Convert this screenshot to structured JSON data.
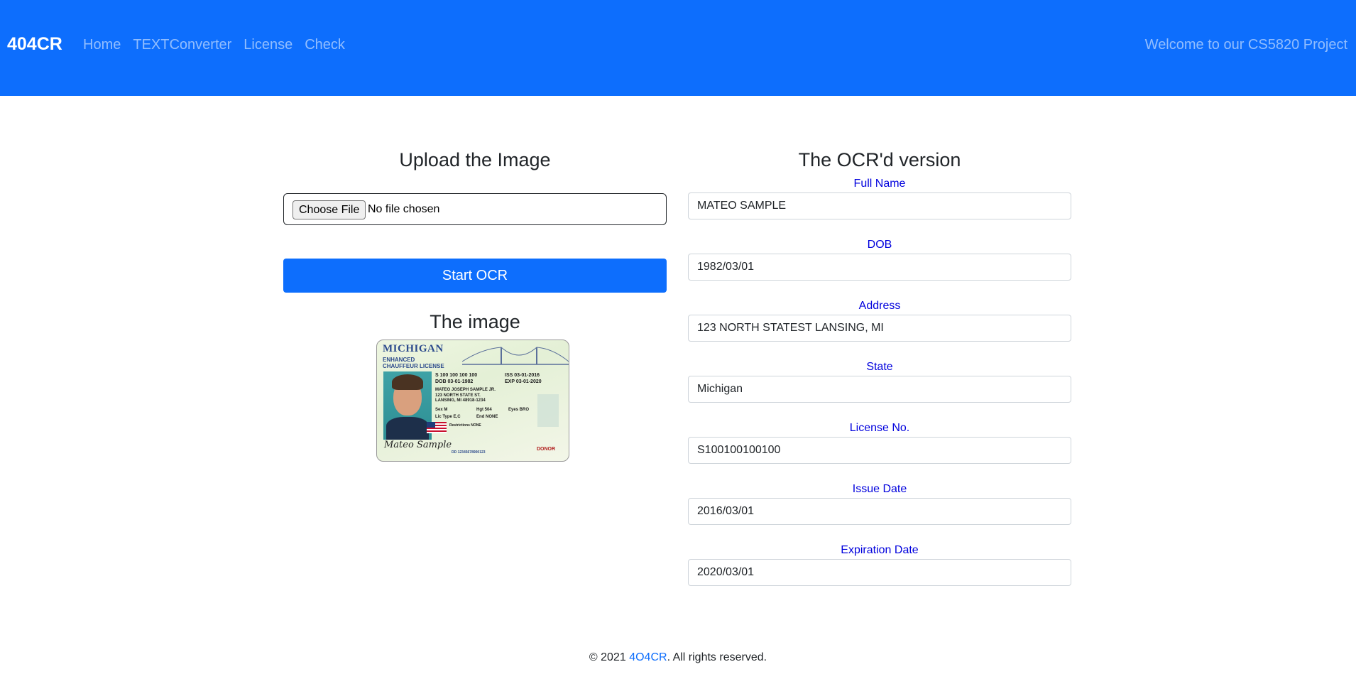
{
  "navbar": {
    "brand": "404CR",
    "links": [
      "Home",
      "TEXTConverter",
      "License",
      "Check"
    ],
    "welcome": "Welcome to our CS5820 Project",
    "background_color": "#0d6efd"
  },
  "upload": {
    "heading": "Upload the Image",
    "choose_file_label": "Choose File",
    "file_status": "No file chosen",
    "start_button": "Start OCR",
    "image_heading": "The image"
  },
  "license_image": {
    "state_title": "MICHIGAN",
    "type_line1": "ENHANCED",
    "type_line2": "CHAUFFEUR LICENSE",
    "number": "S 100 100 100 100",
    "dob": "DOB 03-01-1982",
    "iss": "ISS 03-01-2016",
    "exp": "EXP 03-01-2020",
    "name": "MATEO JOSEPH SAMPLE JR.",
    "street": "123 NORTH STATE ST.",
    "city": "LANSING, MI 48918-1234",
    "sex": "Sex M",
    "hgt": "Hgt 504",
    "eyes": "Eyes BRO",
    "lic_type": "Lic Type E,C",
    "end": "End NONE",
    "restrictions": "Restrictions NONE",
    "dd": "DD 12345678900123",
    "signature": "Mateo Sample",
    "donor": "DONOR"
  },
  "ocr": {
    "heading": "The OCR'd version",
    "fields": [
      {
        "label": "Full Name",
        "value": "MATEO SAMPLE"
      },
      {
        "label": "DOB",
        "value": "1982/03/01"
      },
      {
        "label": "Address",
        "value": "123 NORTH STATEST LANSING, MI"
      },
      {
        "label": "State",
        "value": "Michigan"
      },
      {
        "label": "License No.",
        "value": "S100100100100"
      },
      {
        "label": "Issue Date",
        "value": "2016/03/01"
      },
      {
        "label": "Expiration Date",
        "value": "2020/03/01"
      }
    ]
  },
  "footer": {
    "prefix": "© 2021 ",
    "link": "4O4CR",
    "suffix": ". All rights reserved."
  }
}
